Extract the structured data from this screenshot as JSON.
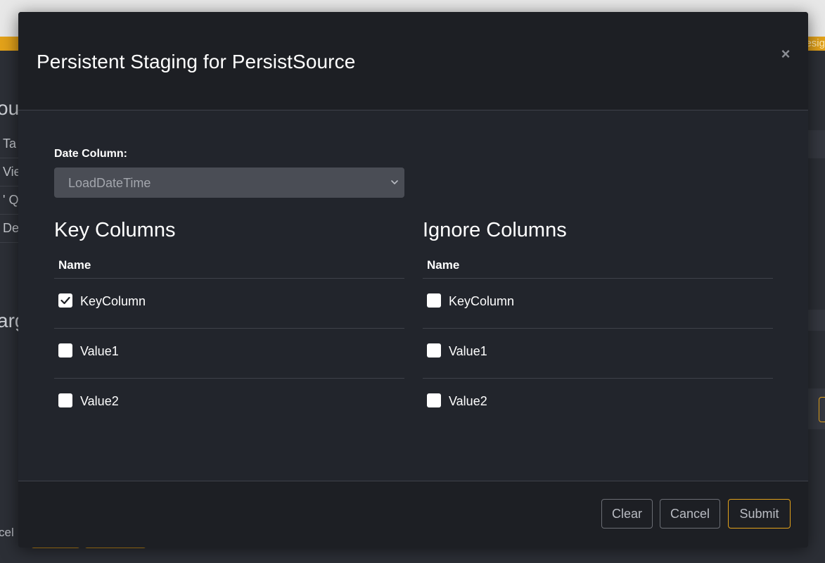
{
  "background": {
    "orange_bar_text": "esig",
    "heading_1": "ou",
    "heading_2": "arg",
    "items": [
      "Ta",
      "Vie",
      "' Qu",
      "De"
    ],
    "bottom_text": "cel"
  },
  "modal": {
    "title": "Persistent Staging for PersistSource",
    "close_symbol": "×",
    "date_column": {
      "label": "Date Column:",
      "selected": "LoadDateTime"
    },
    "key_columns": {
      "title": "Key Columns",
      "header": "Name",
      "rows": [
        {
          "name": "KeyColumn",
          "checked": true
        },
        {
          "name": "Value1",
          "checked": false
        },
        {
          "name": "Value2",
          "checked": false
        }
      ]
    },
    "ignore_columns": {
      "title": "Ignore Columns",
      "header": "Name",
      "rows": [
        {
          "name": "KeyColumn",
          "checked": false
        },
        {
          "name": "Value1",
          "checked": false
        },
        {
          "name": "Value2",
          "checked": false
        }
      ]
    },
    "footer": {
      "clear_label": "Clear",
      "cancel_label": "Cancel",
      "submit_label": "Submit"
    }
  },
  "colors": {
    "accent": "#e3a21a",
    "modal_bg": "#22252c",
    "header_bg": "#1d1f24",
    "select_bg": "#4a4d55"
  }
}
